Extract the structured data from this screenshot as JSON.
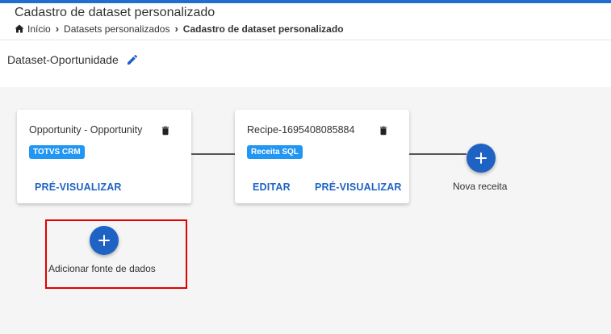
{
  "header": {
    "title": "Cadastro de dataset personalizado",
    "breadcrumb": [
      {
        "label": "Início",
        "icon": "home-icon"
      },
      {
        "label": "Datasets personalizados"
      },
      {
        "label": "Cadastro de dataset personalizado"
      }
    ]
  },
  "dataset": {
    "name": "Dataset-Oportunidade",
    "edit_icon": "pencil-icon"
  },
  "cards": [
    {
      "title": "Opportunity - Opportunity",
      "tag": "TOTVS CRM",
      "actions": [
        "PRÉ-VISUALIZAR"
      ]
    },
    {
      "title": "Recipe-1695408085884",
      "tag": "Receita SQL",
      "actions": [
        "EDITAR",
        "PRÉ-VISUALIZAR"
      ]
    }
  ],
  "new_recipe": {
    "label": "Nova receita"
  },
  "add_source": {
    "label": "Adicionar fonte de dados"
  },
  "colors": {
    "accent": "#1e63c4",
    "chip": "#2196f3",
    "highlight": "#e00000"
  }
}
